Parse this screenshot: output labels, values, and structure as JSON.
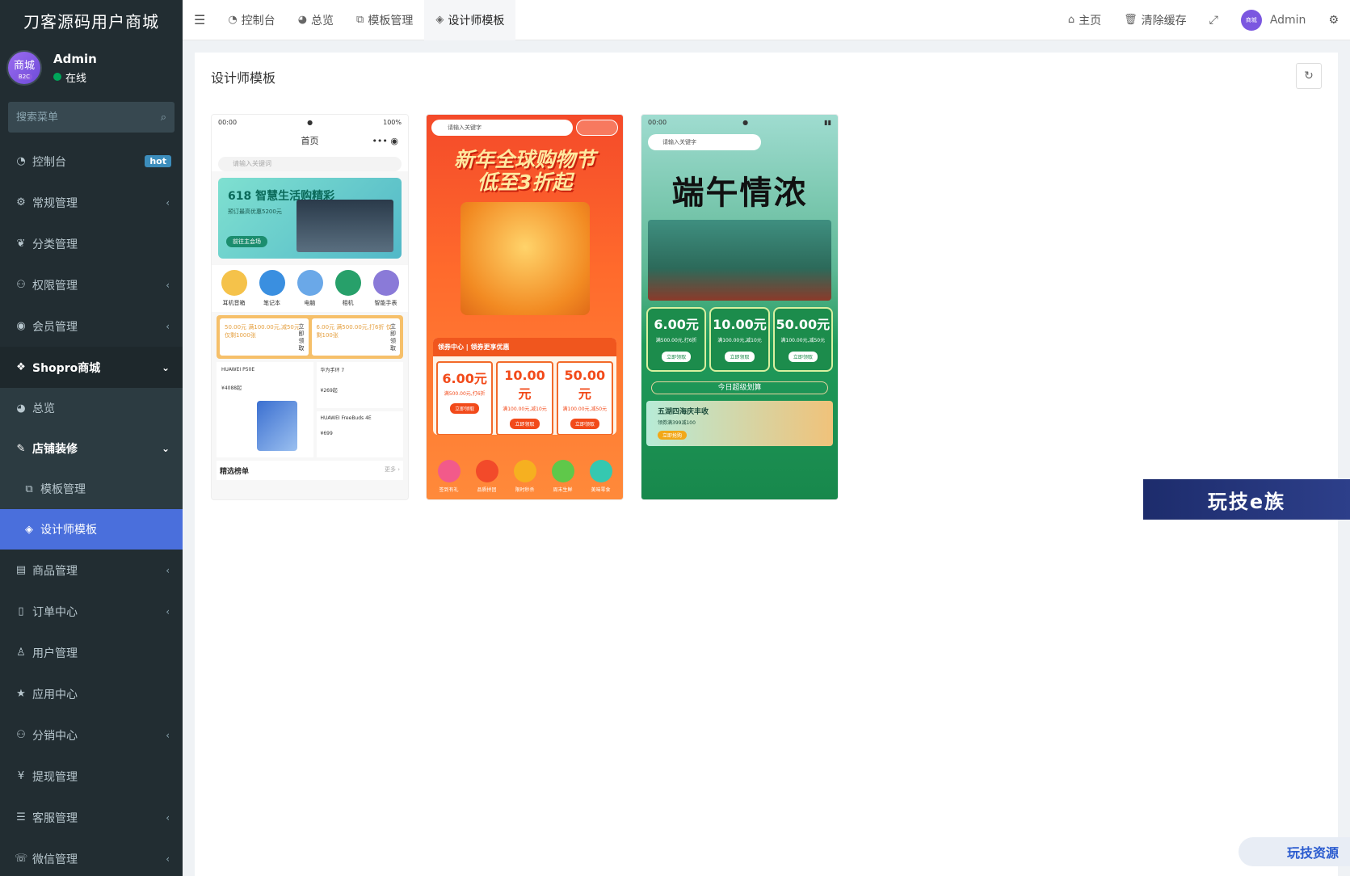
{
  "app": {
    "brand": "刀客源码用户商城"
  },
  "user": {
    "avatar_text": "商城",
    "avatar_sub": "B2C",
    "name": "Admin",
    "status": "在线"
  },
  "sidebar": {
    "search_placeholder": "搜索菜单",
    "items": [
      {
        "label": "控制台",
        "icon": "dashboard-icon",
        "badge": "hot"
      },
      {
        "label": "常规管理",
        "icon": "cogs-icon",
        "arrow": "‹"
      },
      {
        "label": "分类管理",
        "icon": "leaf-icon"
      },
      {
        "label": "权限管理",
        "icon": "group-icon",
        "arrow": "‹"
      },
      {
        "label": "会员管理",
        "icon": "user-circle-icon",
        "arrow": "‹"
      },
      {
        "label": "Shopro商城",
        "icon": "dropbox-icon",
        "arrow": "⌄"
      },
      {
        "label": "总览",
        "icon": "pie-chart-icon"
      },
      {
        "label": "店铺装修",
        "icon": "brush-icon",
        "arrow": "⌄"
      },
      {
        "label": "模板管理",
        "icon": "cubes-icon"
      },
      {
        "label": "设计师模板",
        "icon": "cube-icon"
      },
      {
        "label": "商品管理",
        "icon": "inbox-icon",
        "arrow": "‹"
      },
      {
        "label": "订单中心",
        "icon": "file-icon",
        "arrow": "‹"
      },
      {
        "label": "用户管理",
        "icon": "user-icon"
      },
      {
        "label": "应用中心",
        "icon": "star-icon"
      },
      {
        "label": "分销中心",
        "icon": "users-icon",
        "arrow": "‹"
      },
      {
        "label": "提现管理",
        "icon": "yen-icon"
      },
      {
        "label": "客服管理",
        "icon": "list-icon",
        "arrow": "‹"
      },
      {
        "label": "微信管理",
        "icon": "wechat-icon",
        "arrow": "‹"
      }
    ]
  },
  "topnav": {
    "tabs": [
      {
        "label": "控制台"
      },
      {
        "label": "总览"
      },
      {
        "label": "模板管理"
      },
      {
        "label": "设计师模板"
      }
    ],
    "home": "主页",
    "clear_cache": "清除缓存",
    "admin": "Admin",
    "avatar_text": "商城"
  },
  "main": {
    "title": "设计师模板"
  },
  "templates": {
    "t1": {
      "time": "00:00",
      "battery": "100%",
      "page_title": "首页",
      "search": "请输入关键词",
      "banner_title": "618 智慧生活购精彩",
      "banner_sub": "预订最高优惠5200元",
      "banner_btn": "前往主会场",
      "cats": [
        "耳机音箱",
        "笔记本",
        "电脑",
        "相机",
        "智能手表"
      ],
      "coupon1": "50.00元 满100.00元,减50元 仅剩1000张",
      "coupon2": "6.00元 满500.00元,打6折 仅剩100张",
      "coupon_side": "立即领取",
      "g1_name": "HUAWEI P50E",
      "g1_price": "¥4088起",
      "g2_name": "华为手环 7",
      "g2_price": "¥269起",
      "g3_name": "HUAWEI FreeBuds 4E",
      "g3_price": "¥699",
      "rank": "精选榜单",
      "more": "更多 ›"
    },
    "t2": {
      "search": "请输入关键字",
      "headline1": "新年全球购物节",
      "headline2": "低至3折起",
      "coupon_head": "领券中心 | 领券更享优惠",
      "coupons": [
        {
          "v": "6.00元",
          "d": "满500.00元,打6折",
          "b": "立即领取"
        },
        {
          "v": "10.00元",
          "d": "满100.00元,减10元",
          "b": "立即领取"
        },
        {
          "v": "50.00元",
          "d": "满100.00元,减50元",
          "b": "立即领取"
        }
      ],
      "icons": [
        "签到有礼",
        "品质拼团",
        "限时秒杀",
        "周末生鲜",
        "美味零食"
      ]
    },
    "t3": {
      "time": "00:00",
      "search": "请输入关键字",
      "title": "端午情浓",
      "coupons": [
        {
          "v": "6.00元",
          "d": "满500.00元,打6折",
          "b": "立即领取"
        },
        {
          "v": "10.00元",
          "d": "满100.00元,减10元",
          "b": "立即领取"
        },
        {
          "v": "50.00元",
          "d": "满100.00元,减50元",
          "b": "立即领取"
        }
      ],
      "today": "今日超级划算",
      "harvest": "五湖四海庆丰收",
      "harvest_sub": "领券满399减100",
      "harvest_tag": "立即抢购"
    }
  },
  "watermarks": {
    "w1": "玩技e族",
    "w2": "玩技资源"
  },
  "colors": {
    "sidebar_bg": "#222d32",
    "active": "#4a6fdc",
    "hot_badge": "#3c8dbc",
    "online": "#00a65a"
  }
}
